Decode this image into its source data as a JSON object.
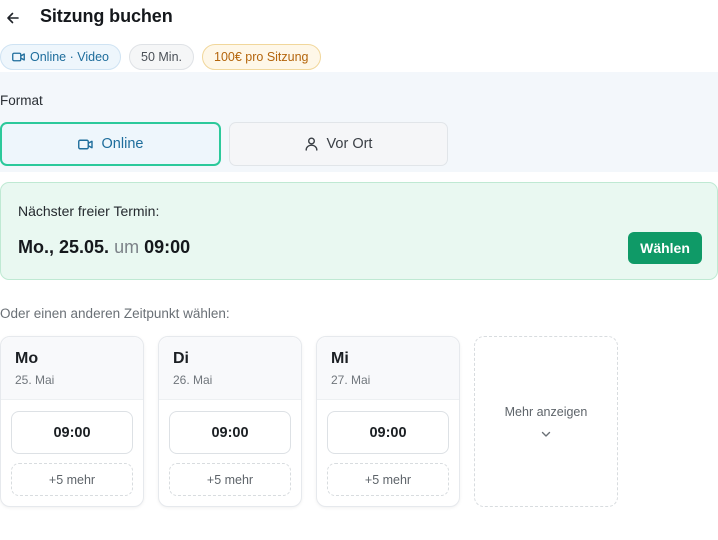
{
  "header": {
    "title": "Sitzung buchen",
    "back_icon": "arrow-left-icon"
  },
  "tags": {
    "online": "Online · Video",
    "duration": "50 Min.",
    "price": "100€ pro Sitzung"
  },
  "format": {
    "label": "Format",
    "options": [
      {
        "label": "Online",
        "icon": "video-icon",
        "selected": true
      },
      {
        "label": "Vor Ort",
        "icon": "user-icon",
        "selected": false
      }
    ]
  },
  "next_slot": {
    "label": "Nächster freier Termin:",
    "date": "Mo., 25.05.",
    "connector": "um",
    "time": "09:00",
    "button": "Wählen"
  },
  "other": {
    "label": "Oder einen anderen Zeitpunkt wählen:"
  },
  "days": [
    {
      "name": "Mo",
      "date": "25. Mai",
      "slot": "09:00",
      "more": "+5 mehr"
    },
    {
      "name": "Di",
      "date": "26. Mai",
      "slot": "09:00",
      "more": "+5 mehr"
    },
    {
      "name": "Mi",
      "date": "27. Mai",
      "slot": "09:00",
      "more": "+5 mehr"
    }
  ],
  "show_more": {
    "label": "Mehr anzeigen",
    "icon": "chevron-down-icon"
  },
  "colors": {
    "accent_green": "#0f9a67",
    "selected_border": "#2cc99b",
    "online_blue": "#1e6d9c",
    "price_orange": "#b4650c"
  }
}
